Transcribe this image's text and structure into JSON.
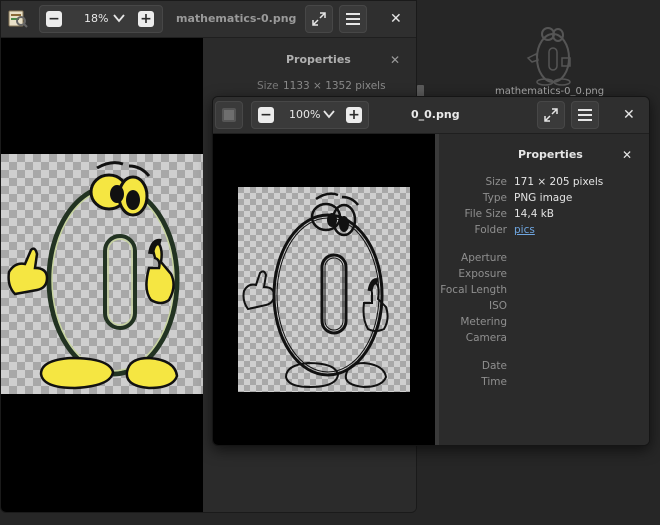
{
  "back_window": {
    "title": "mathematics-0.png",
    "zoom": "18%",
    "properties_title": "Properties",
    "size_label": "Size",
    "size_value": "1133 × 1352 pixels"
  },
  "desktop_icon": {
    "label": "mathematics-0_0.png"
  },
  "front_window": {
    "title": "0_0.png",
    "zoom": "100%",
    "properties_title": "Properties",
    "properties": [
      {
        "label": "Size",
        "value": "171 × 205 pixels"
      },
      {
        "label": "Type",
        "value": "PNG image"
      },
      {
        "label": "File Size",
        "value": "14,4 kB"
      },
      {
        "label": "Folder",
        "value": "pics"
      },
      {
        "label": "Aperture",
        "value": ""
      },
      {
        "label": "Exposure",
        "value": ""
      },
      {
        "label": "Focal Length",
        "value": ""
      },
      {
        "label": "ISO",
        "value": ""
      },
      {
        "label": "Metering",
        "value": ""
      },
      {
        "label": "Camera",
        "value": ""
      },
      {
        "label": "Date",
        "value": ""
      },
      {
        "label": "Time",
        "value": ""
      }
    ]
  },
  "colors": {
    "link": "#6fa6e0",
    "background": "#262626",
    "panel": "#2b2b2b"
  }
}
